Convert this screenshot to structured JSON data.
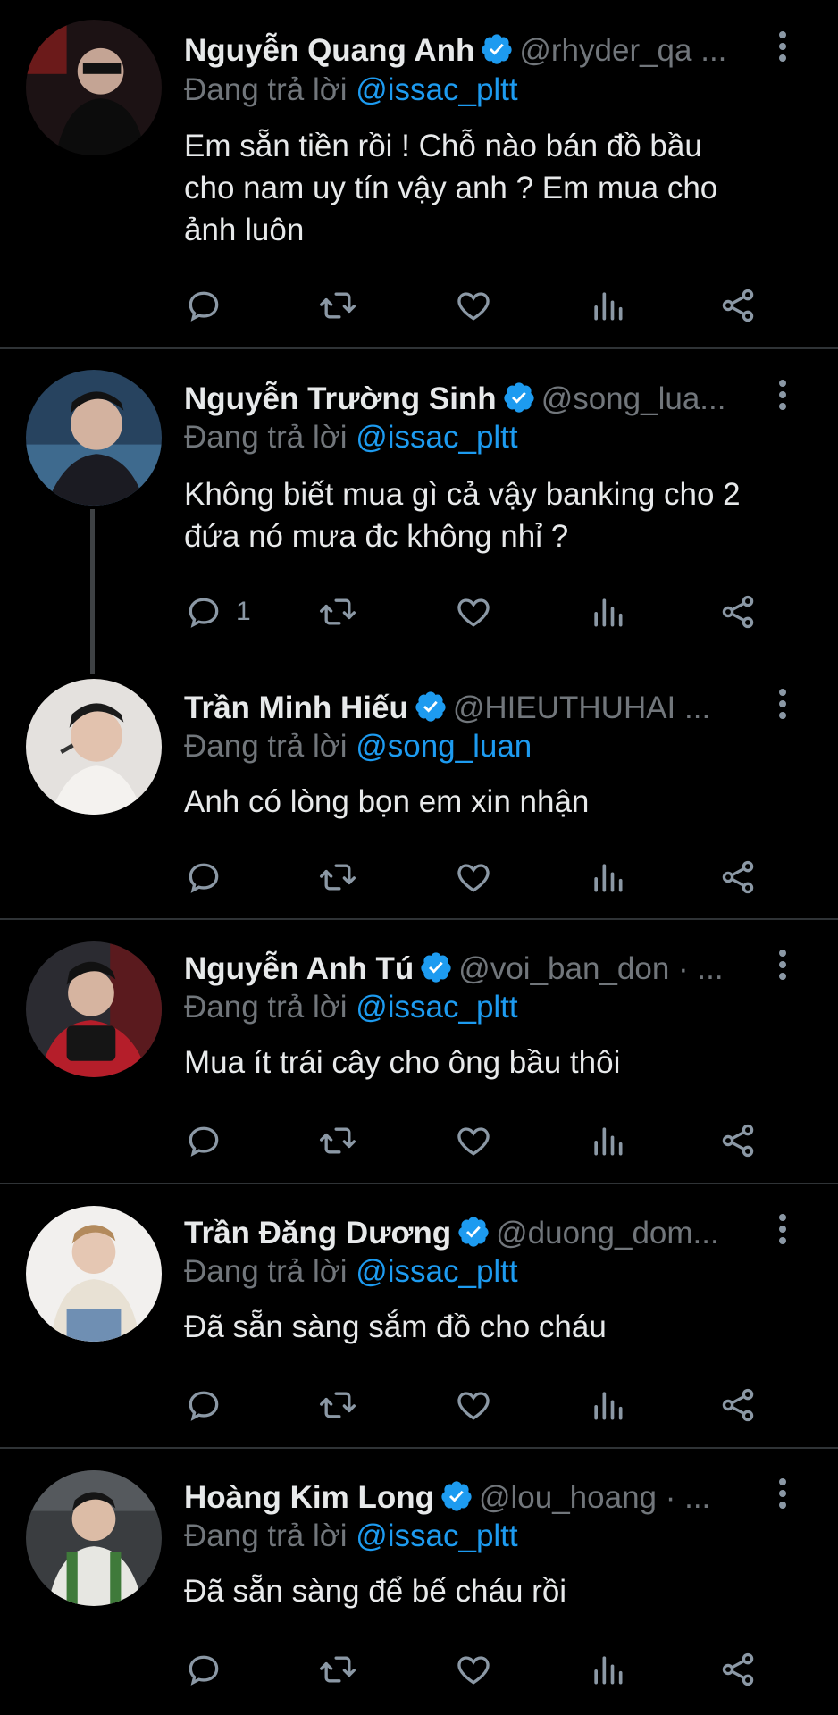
{
  "replying_prefix": "Đang trả lời",
  "tweets": [
    {
      "name": "Nguyễn Quang Anh",
      "handle": "@rhyder_qa ...",
      "replying_to": "@issac_pltt",
      "text_lines": [
        "Em sẵn tiền rồi ! Chỗ nào bán đồ bầu",
        "cho nam uy tín vậy anh ? Em mua cho",
        "ảnh luôn"
      ],
      "reply_count": ""
    },
    {
      "name": "Nguyễn Trường Sinh",
      "handle": "@song_lua...",
      "replying_to": "@issac_pltt",
      "text_lines": [
        "Không biết mua gì cả vậy banking cho 2",
        "đứa nó mưa đc không nhỉ ?"
      ],
      "reply_count": "1"
    },
    {
      "name": "Trần Minh Hiếu",
      "handle": "@HIEUTHUHAI ...",
      "replying_to": "@song_luan",
      "text_lines": [
        "Anh có lòng bọn em xin nhận"
      ],
      "reply_count": ""
    },
    {
      "name": "Nguyễn Anh Tú",
      "handle": "@voi_ban_don · ...",
      "replying_to": "@issac_pltt",
      "text_lines": [
        "Mua ít trái cây cho ông bầu thôi"
      ],
      "reply_count": ""
    },
    {
      "name": "Trần Đăng Dương",
      "handle": "@duong_dom...",
      "replying_to": "@issac_pltt",
      "text_lines": [
        "Đã sẵn sàng sắm đồ cho cháu"
      ],
      "reply_count": ""
    },
    {
      "name": "Hoàng Kim Long",
      "handle": "@lou_hoang · ...",
      "replying_to": "@issac_pltt",
      "text_lines": [
        "Đã sẵn sàng để bế cháu rồi"
      ],
      "reply_count": ""
    }
  ],
  "colors": {
    "background": "#000000",
    "text": "#e7e9ea",
    "muted": "#71767b",
    "accent": "#1d9bf0",
    "divider": "#2f3336"
  },
  "icons": [
    "verified-badge-icon",
    "more-options-icon",
    "reply-icon",
    "retweet-icon",
    "like-icon",
    "views-icon",
    "share-icon"
  ]
}
